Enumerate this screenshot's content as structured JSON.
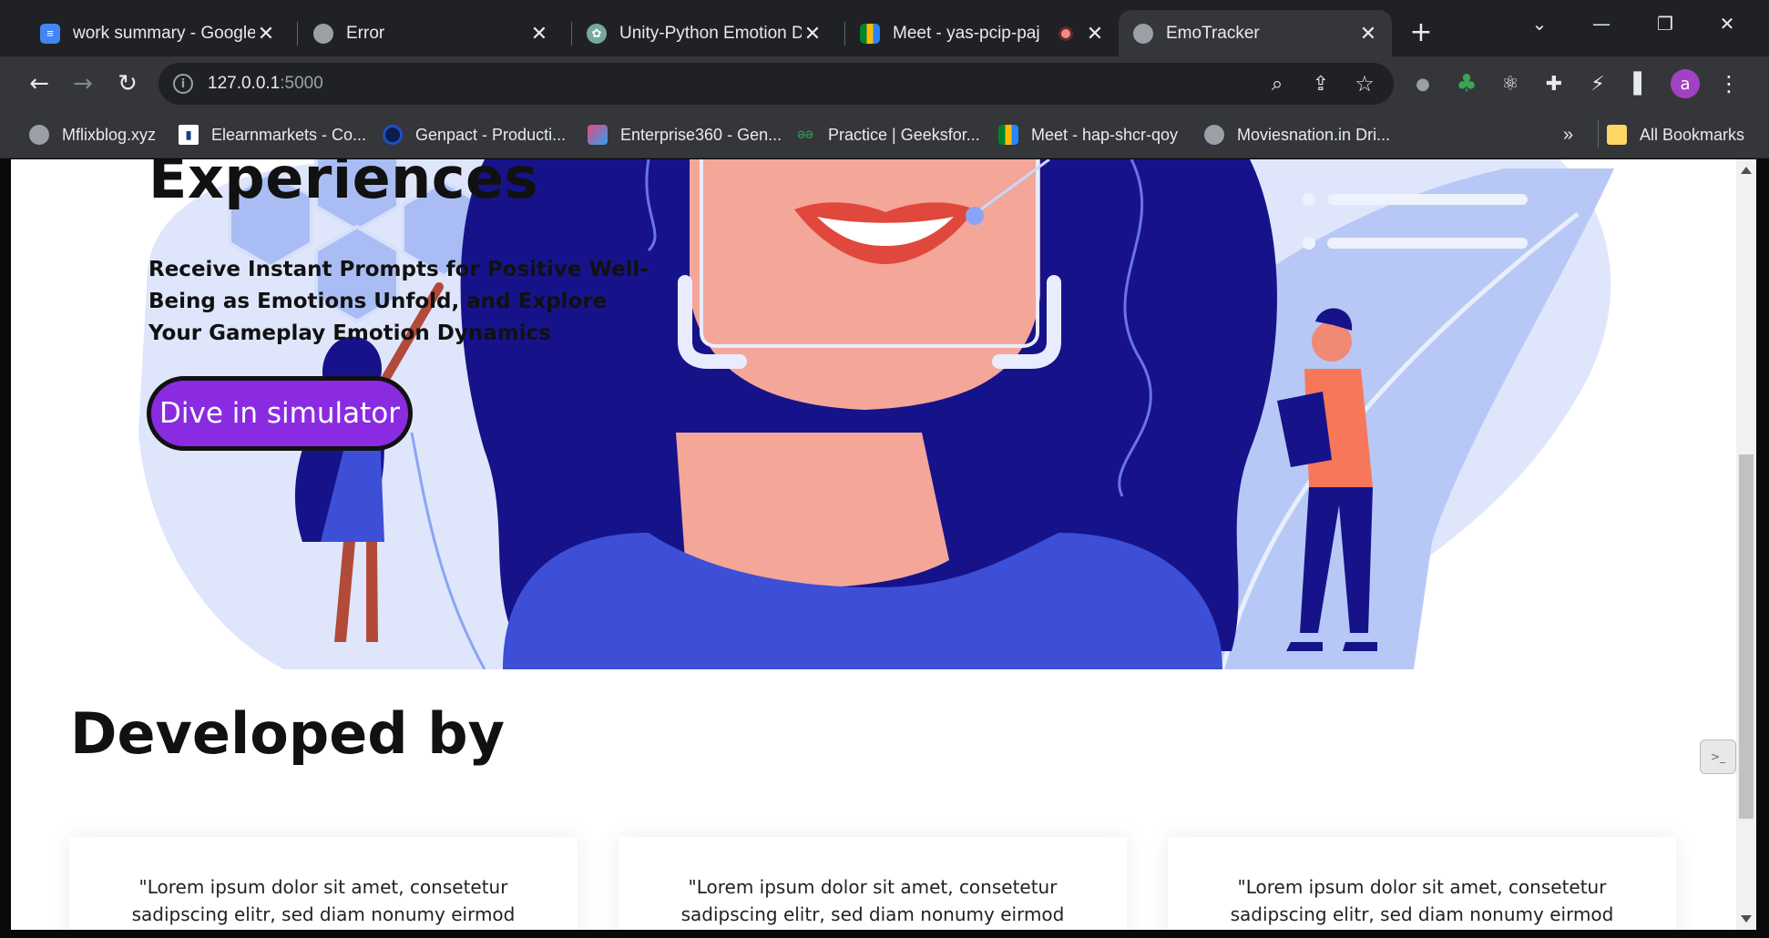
{
  "tabs": [
    {
      "title": "work summary - Google Docs",
      "icon": "google-docs-icon"
    },
    {
      "title": "Error",
      "icon": "globe-icon"
    },
    {
      "title": "Unity-Python Emotion Data",
      "icon": "chatgpt-icon"
    },
    {
      "title": "Meet - yas-pcip-paj",
      "icon": "google-meet-icon"
    },
    {
      "title": "EmoTracker",
      "icon": "globe-icon",
      "active": true
    }
  ],
  "address": {
    "host": "127.0.0.1",
    "port": ":5000"
  },
  "bookmarks": [
    {
      "label": "Mflixblog.xyz",
      "icon": "globe-icon"
    },
    {
      "label": "Elearnmarkets - Co...",
      "icon": "elearnmarkets-icon"
    },
    {
      "label": "Genpact - Producti...",
      "icon": "genpact-icon"
    },
    {
      "label": "Enterprise360 - Gen...",
      "icon": "enterprise360-icon"
    },
    {
      "label": "Practice | Geeksfor...",
      "icon": "geeksforgeeks-icon"
    },
    {
      "label": "Meet - hap-shcr-qoy",
      "icon": "google-meet-icon"
    },
    {
      "label": "Moviesnation.in Dri...",
      "icon": "globe-icon"
    }
  ],
  "bookmarks_overflow": "»",
  "all_bookmarks": "All Bookmarks",
  "avatar_letter": "a",
  "page": {
    "hero_heading": "Experiences",
    "hero_subtitle": "Receive Instant Prompts for Positive Well-Being as Emotions Unfold, and Explore Your Gameplay Emotion Dynamics",
    "cta_label": "Dive in simulator",
    "developed_heading": "Developed by",
    "cards": [
      {
        "quote": "\"Lorem ipsum dolor sit amet, consetetur sadipscing elitr, sed diam nonumy eirmod"
      },
      {
        "quote": "\"Lorem ipsum dolor sit amet, consetetur sadipscing elitr, sed diam nonumy eirmod"
      },
      {
        "quote": "\"Lorem ipsum dolor sit amet, consetetur sadipscing elitr, sed diam nonumy eirmod"
      }
    ]
  },
  "colors": {
    "cta": "#8a2be2",
    "hair": "#16138a",
    "skin": "#f4a698",
    "shirt": "#3d4fd6",
    "backdrop": "#b8c8f6",
    "backdrop_light": "#dfe6fb"
  }
}
